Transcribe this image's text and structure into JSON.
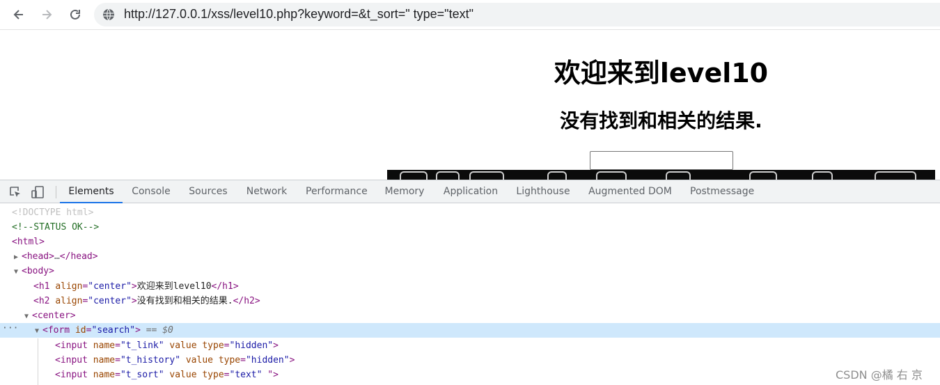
{
  "browser": {
    "url": "http://127.0.0.1/xss/level10.php?keyword=&t_sort=\" type=\"text\"",
    "back_icon": "arrow-left",
    "forward_icon": "arrow-right",
    "reload_icon": "reload",
    "site_info_icon": "globe"
  },
  "page": {
    "h1": "欢迎来到level10",
    "h2": "没有找到和相关的结果.",
    "input_value": ""
  },
  "devtools": {
    "tabs": [
      "Elements",
      "Console",
      "Sources",
      "Network",
      "Performance",
      "Memory",
      "Application",
      "Lighthouse",
      "Augmented DOM",
      "Postmessage"
    ],
    "active_tab": "Elements",
    "dom": {
      "doctype": "<!DOCTYPE html>",
      "comment": "<!--STATUS OK-->",
      "html": "<html>",
      "head_open": "<head>",
      "head_ellipsis": "…",
      "head_close": "</head>",
      "body": "<body>",
      "h1_open": "<h1",
      "h1_attr": "align",
      "h1_val": "\"center\"",
      "h1_text": "欢迎来到level10",
      "h1_close": "</h1>",
      "h2_open": "<h2",
      "h2_attr": "align",
      "h2_val": "\"center\"",
      "h2_text": "没有找到和相关的结果.",
      "h2_close": "</h2>",
      "center": "<center>",
      "form_open": "<form",
      "form_attr": "id",
      "form_val": "\"search\"",
      "selected_marker": "== $0",
      "inputs": [
        {
          "name": "\"t_link\"",
          "type": "\"hidden\"",
          "tail": ">"
        },
        {
          "name": "\"t_history\"",
          "type": "\"hidden\"",
          "tail": ">"
        },
        {
          "name": "\"t_sort\"",
          "type": "\"text\"",
          "tail": " \">"
        }
      ]
    }
  },
  "watermark": "CSDN @橘 右 京",
  "colors": {
    "accent": "#1a73e8",
    "selection": "#cfe8fc",
    "tag": "#881280",
    "attr": "#994500",
    "value": "#1a1aa6"
  }
}
